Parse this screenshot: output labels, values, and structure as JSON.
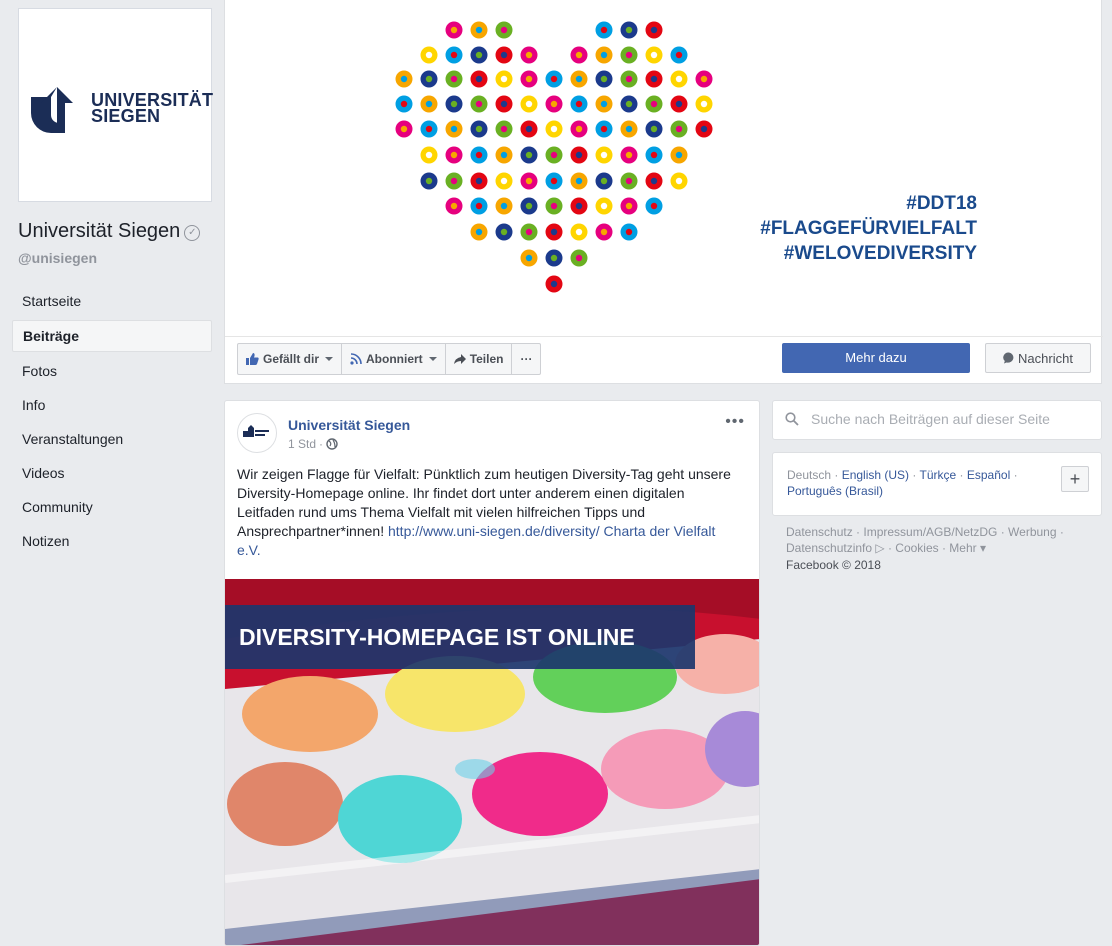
{
  "profile": {
    "logo_line1": "UNIVERSITÄT",
    "logo_line2": "SIEGEN",
    "name": "Universität Siegen",
    "handle": "@unisiegen"
  },
  "nav": {
    "items": [
      "Startseite",
      "Beiträge",
      "Fotos",
      "Info",
      "Veranstaltungen",
      "Videos",
      "Community",
      "Notizen"
    ],
    "active": "Beiträge"
  },
  "cover": {
    "hashtags": [
      "#DDT18",
      "#FLAGGEFÜRVIELFALT",
      "#WELOVEDIVERSITY"
    ],
    "dot_colors": [
      "#e6007e",
      "#009fe3",
      "#f7a600",
      "#1b3a8c",
      "#6ab023",
      "#e30613",
      "#ffd500"
    ]
  },
  "actions": {
    "like": "Gefällt dir",
    "follow": "Abonniert",
    "share": "Teilen",
    "more": "···",
    "more_info": "Mehr dazu",
    "message": "Nachricht"
  },
  "post": {
    "author": "Universität Siegen",
    "time": "1 Std",
    "menu": "•••",
    "text": "Wir zeigen Flagge für Vielfalt: Pünktlich zum heutigen Diversity-Tag geht unsere Diversity-Homepage online. Ihr findet dort unter anderem einen digitalen Leitfaden rund ums Thema Vielfalt mit vielen hilfreichen Tipps und Ansprechpartner*innen! ",
    "link": "http://www.uni-siegen.de/diversity/",
    "link2": "Charta der Vielfalt e.V.",
    "image_banner": "DIVERSITY-HOMEPAGE IST ONLINE"
  },
  "search": {
    "placeholder": "Suche nach Beiträgen auf dieser Seite"
  },
  "languages": {
    "current": "Deutsch",
    "others": [
      "English (US)",
      "Türkçe",
      "Español",
      "Português (Brasil)"
    ],
    "add": "+"
  },
  "footer": {
    "links": "Datenschutz · Impressum/AGB/NetzDG · Werbung · Datenschutzinfo ▷ · Cookies · Mehr ▾",
    "copyright": "Facebook © 2018"
  }
}
